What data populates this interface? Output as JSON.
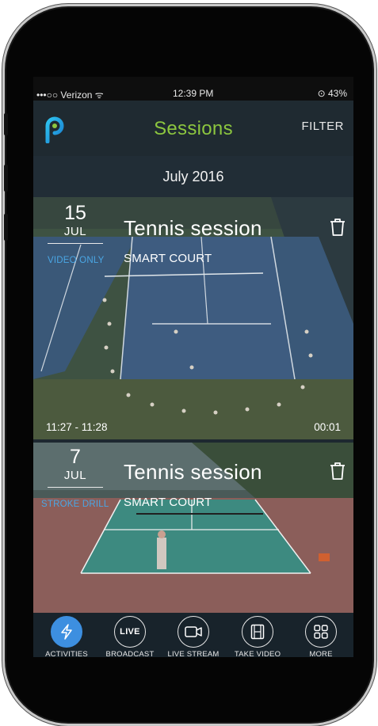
{
  "status_bar": {
    "carrier": "•••○○ Verizon ᯤ",
    "time": "12:39 PM",
    "battery": "⊙ 43%"
  },
  "header": {
    "title": "Sessions",
    "filter_label": "FILTER",
    "logo_icon": "p-logo-icon"
  },
  "section": {
    "title": "July 2016"
  },
  "sessions": [
    {
      "day": "15",
      "month": "JUL",
      "badge": "VIDEO ONLY",
      "title": "Tennis session",
      "subtitle": "SMART COURT",
      "time_range": "11:27 - 11:28",
      "duration": "00:01"
    },
    {
      "day": "7",
      "month": "JUL",
      "badge": "STROKE DRILL",
      "title": "Tennis session",
      "subtitle": "SMART COURT"
    }
  ],
  "tabs": [
    {
      "label": "ACTIVITIES",
      "icon": "lightning-icon",
      "active": true
    },
    {
      "label": "BROADCAST",
      "icon": "live-icon",
      "icon_text": "LIVE"
    },
    {
      "label": "LIVE STREAM",
      "icon": "camera-icon"
    },
    {
      "label": "TAKE VIDEO",
      "icon": "film-icon"
    },
    {
      "label": "MORE",
      "icon": "grid-icon"
    }
  ],
  "colors": {
    "accent_green": "#8cc63f",
    "accent_blue": "#3d8fe0",
    "badge_blue": "#4aa6e4",
    "bg_dark": "#1f2a31"
  }
}
